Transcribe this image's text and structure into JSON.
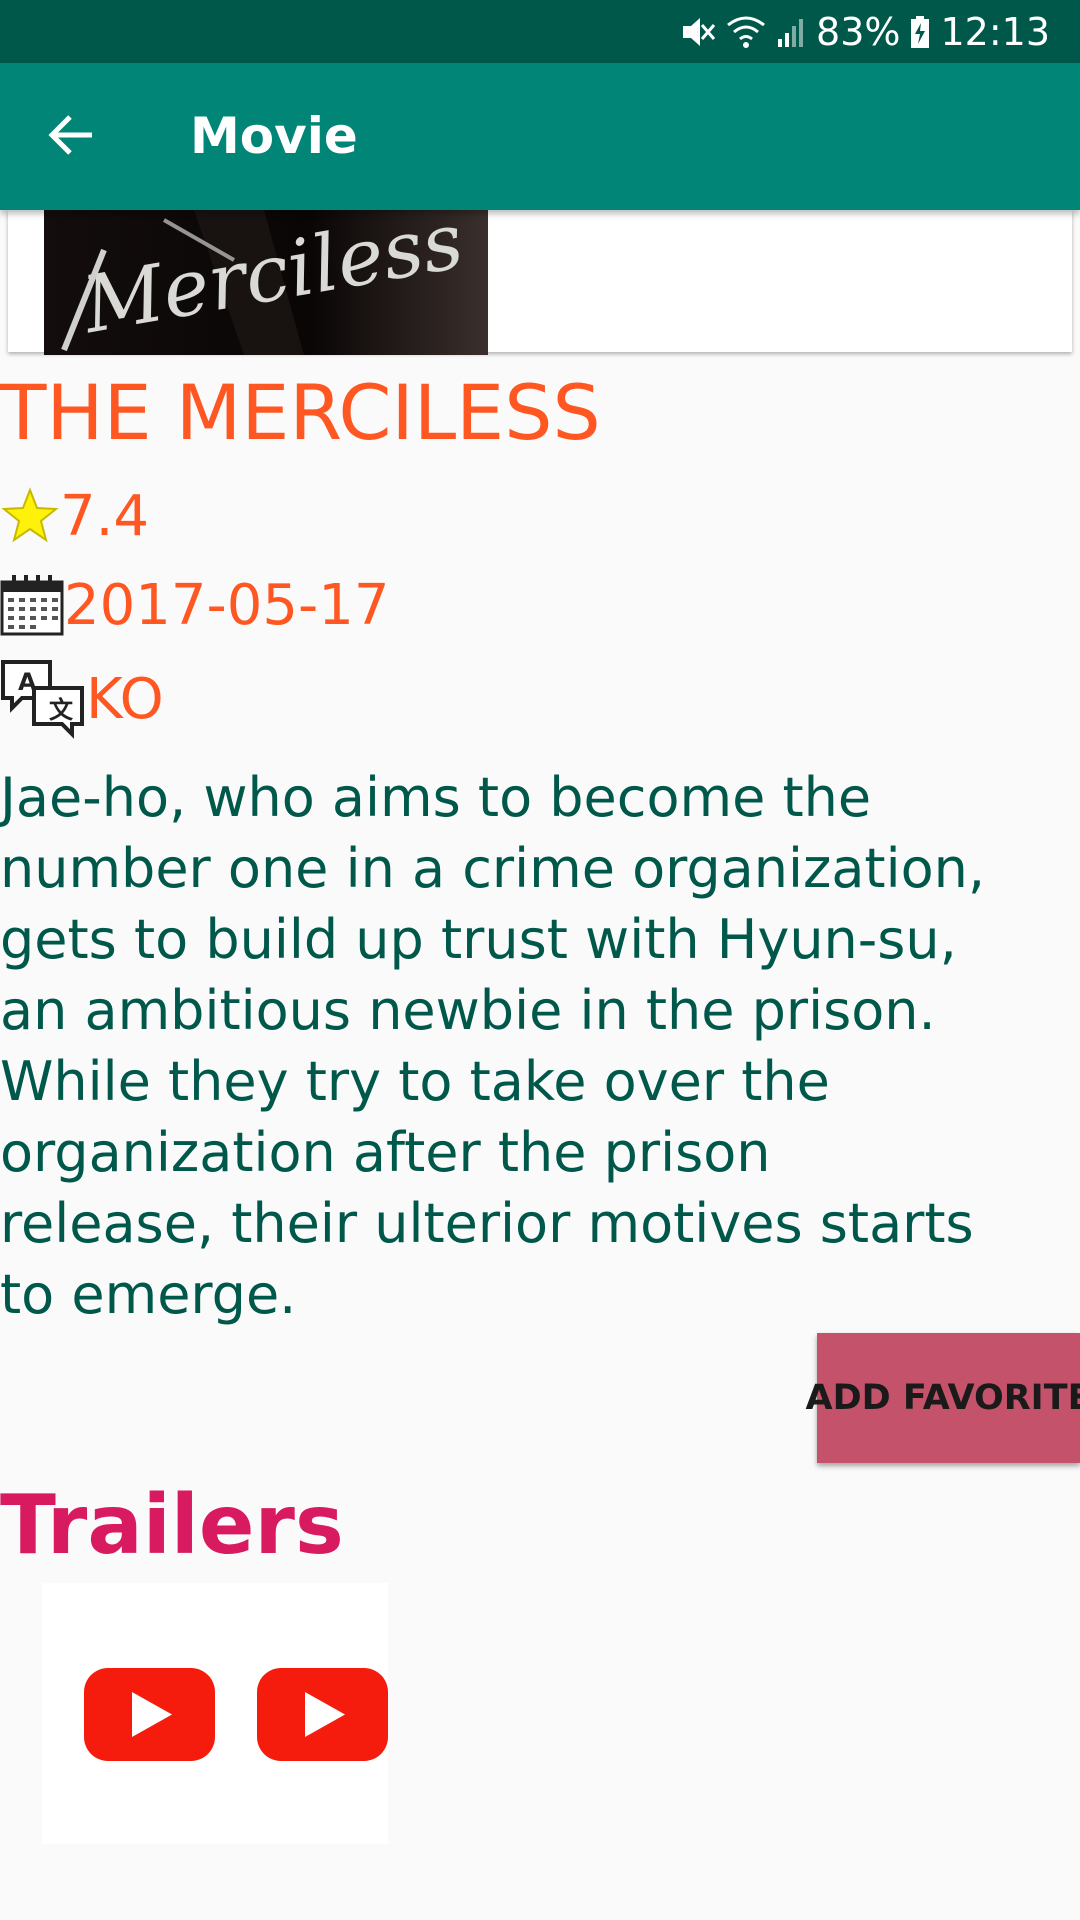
{
  "status_bar": {
    "battery": "83%",
    "time": "12:13"
  },
  "app_bar": {
    "title": "Movie"
  },
  "movie": {
    "poster_text": "Merciless",
    "title": "THE MERCILESS",
    "rating": "7.4",
    "release_date": "2017-05-17",
    "language": "KO",
    "overview": "Jae-ho, who aims to become the number one in a crime organization, gets to build up trust with Hyun-su, an ambitious newbie in the prison. While they try to take over the organization after the prison release, their ulterior motives starts to emerge."
  },
  "actions": {
    "favorite_label": "ADD FAVORITE"
  },
  "trailers": {
    "heading": "Trailers",
    "items": [
      {
        "icon": "youtube-play-icon"
      },
      {
        "icon": "youtube-play-icon"
      }
    ]
  },
  "colors": {
    "status_bar": "#00584a",
    "app_bar": "#008577",
    "title": "#ff5722",
    "overview": "#00584a",
    "favorite_button": "#c5526b",
    "trailers_heading": "#d81b60",
    "youtube_red": "#f61c0d"
  }
}
